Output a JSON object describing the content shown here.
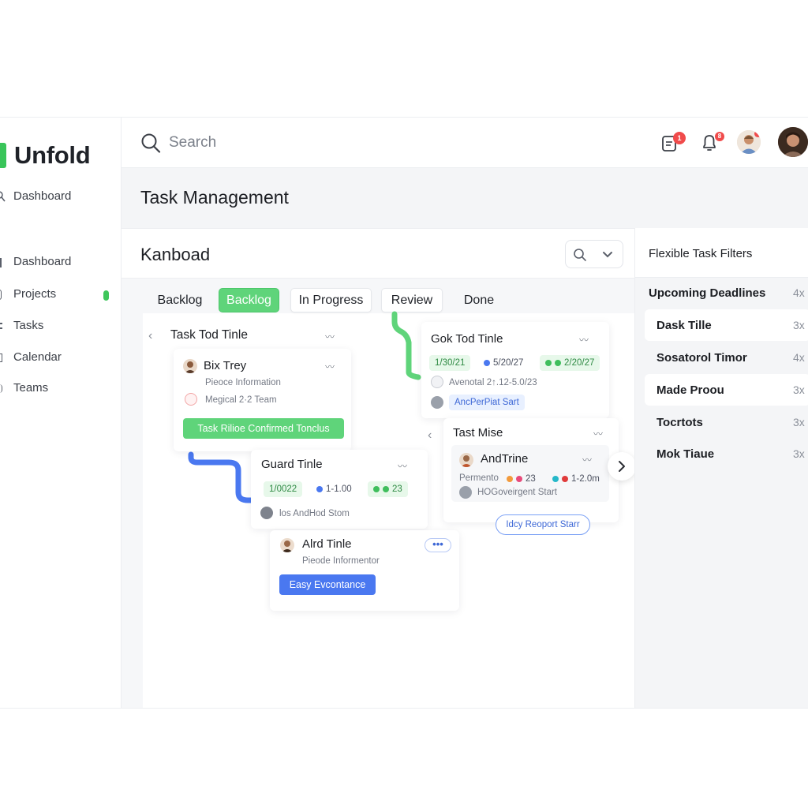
{
  "app": {
    "name": "Unfold",
    "accent": "#39c55a"
  },
  "sidebar": {
    "top_item": "Dashboard",
    "items": [
      {
        "label": "Dashboard"
      },
      {
        "label": "Projects"
      },
      {
        "label": "Tasks"
      },
      {
        "label": "Calendar"
      },
      {
        "label": "Teams"
      }
    ]
  },
  "topbar": {
    "search_placeholder": "Search",
    "clipboard_badge": "1",
    "bell_badge": "8"
  },
  "page": {
    "title": "Task Management"
  },
  "board": {
    "title": "Kanboad",
    "tabs": [
      "Backlog",
      "Backlog",
      "In Progress",
      "Review",
      "Done"
    ],
    "active_tab_index": 1
  },
  "cards": {
    "col1": {
      "title": "Task Tod Tinle"
    },
    "bix": {
      "name": "Bix Trey",
      "info": "Pieoce Information",
      "team": "Megical 2·2 Team",
      "button": "Task Rilioe Confirmed Tonclus"
    },
    "guard": {
      "title": "Guard Tinle",
      "date1": "1/0022",
      "date2": "1-1.00",
      "count": "23",
      "footer": "los AndHod Stom"
    },
    "alrd": {
      "name": "Alrd Tinle",
      "info": "Pieode Informentor",
      "button": "Easy Evcontance"
    },
    "gok": {
      "title": "Gok Tod Tinle",
      "date1": "1/30/21",
      "date2": "5/20/27",
      "date3": "2/20/27",
      "meta": "Avenotal 2↑.12-5.0/23",
      "tag": "AncPerРіаt Sart"
    },
    "tast": {
      "title": "Tast Mise",
      "name": "AndTrine",
      "role": "Permento",
      "count": "23",
      "range": "1-2.0m",
      "footer": "HOGoveirgent Start",
      "button": "Idcy Reoport Starr"
    }
  },
  "filters": {
    "title": "Flexible Task Filters",
    "rows": [
      {
        "label": "Upcoming Deadlines",
        "count": "4x"
      },
      {
        "label": "Dask Tille",
        "count": "3x"
      },
      {
        "label": "Sosatorol Timor",
        "count": "4x"
      },
      {
        "label": "Made Proou",
        "count": "3x"
      },
      {
        "label": "Tocrtots",
        "count": "3x"
      },
      {
        "label": "Mok Tiaue",
        "count": "3x"
      }
    ]
  }
}
